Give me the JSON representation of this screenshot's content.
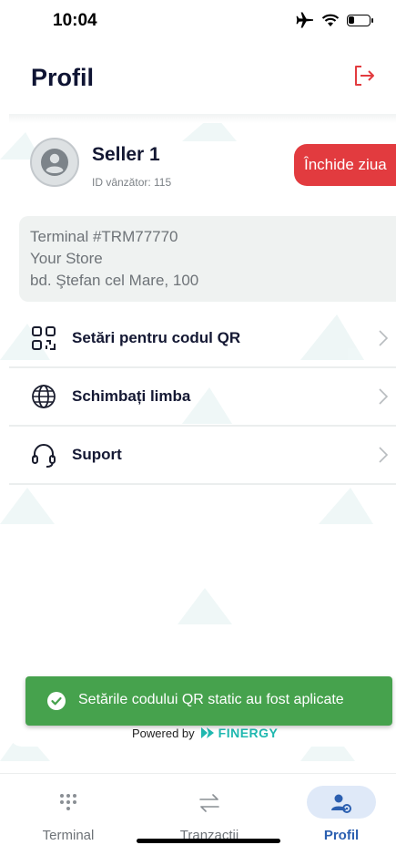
{
  "status_bar": {
    "time": "10:04",
    "battery_level": 0.3
  },
  "header": {
    "title": "Profil",
    "logout_icon": "logout-icon"
  },
  "profile": {
    "seller_name": "Seller 1",
    "seller_id": "ID vânzător: 115",
    "close_day_label": "Închide ziua"
  },
  "terminal": {
    "id": "Terminal #TRM77770",
    "store": "Your Store",
    "address": "bd. Ştefan cel Mare, 100"
  },
  "menu": {
    "items": [
      {
        "label": "Setări pentru codul QR",
        "icon": "qr-code-icon"
      },
      {
        "label": "Schimbați limba",
        "icon": "globe-icon"
      },
      {
        "label": "Suport",
        "icon": "headset-icon"
      }
    ]
  },
  "toast": {
    "message": "Setările codului QR static au fost aplicate"
  },
  "footer": {
    "powered_by": "Powered by",
    "brand": "FINERGY"
  },
  "tabs": [
    {
      "label": "Terminal",
      "icon": "keypad-icon",
      "active": false
    },
    {
      "label": "Tranzacții",
      "icon": "transfer-arrows-icon",
      "active": false
    },
    {
      "label": "Profil",
      "icon": "user-settings-icon",
      "active": true
    }
  ],
  "colors": {
    "accent": "#2b5fb0",
    "danger": "#e23b3f",
    "success": "#46a24d",
    "brand": "#1fb8b0"
  }
}
